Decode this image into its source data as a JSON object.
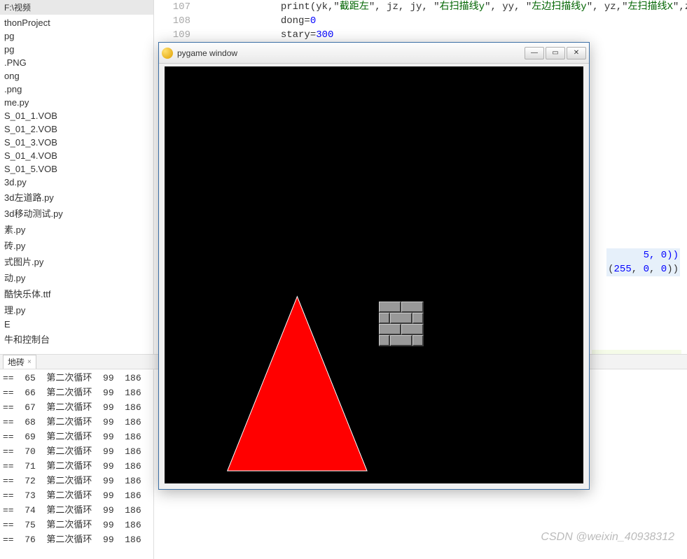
{
  "tree": {
    "header": "F:\\视频",
    "items": [
      "thonProject",
      "pg",
      "pg",
      ".PNG",
      "ong",
      ".png",
      "me.py",
      "S_01_1.VOB",
      "S_01_2.VOB",
      "S_01_3.VOB",
      "S_01_4.VOB",
      "S_01_5.VOB",
      "3d.py",
      "3d左道路.py",
      "3d移动测试.py",
      "素.py",
      "砖.py",
      "式图片.py",
      "动.py",
      "酷快乐体.ttf",
      "理.py",
      "E",
      "牛和控制台"
    ]
  },
  "code": {
    "lines": [
      {
        "n": 107,
        "raw": "print(yk,\"<span class='str'>截距左</span>\", jz, jy, \"<span class='str'>右扫描线y</span>\", yy, \"<span class='str'>左边扫描线y</span>\", yz,\"<span class='str'>左扫描线X</span>\",zuoxianx,\"<span class='str'>左</span>"
      },
      {
        "n": 108,
        "raw": "dong=<span class='num'>0</span>"
      },
      {
        "n": 109,
        "raw": "stary=<span class='num'>300</span>"
      }
    ]
  },
  "farRight": {
    "line1": "5, 0))",
    "line2_pre": "(",
    "line2_a": "255",
    "line2_b": "0",
    "line2_c": "0",
    "line2_post": "))"
  },
  "runTab": {
    "label": "地砖",
    "close": "×"
  },
  "console": {
    "rows": [
      {
        "a": "==",
        "b": "65",
        "c": "第二次循环",
        "d": "99",
        "e": "186"
      },
      {
        "a": "==",
        "b": "66",
        "c": "第二次循环",
        "d": "99",
        "e": "186"
      },
      {
        "a": "==",
        "b": "67",
        "c": "第二次循环",
        "d": "99",
        "e": "186"
      },
      {
        "a": "==",
        "b": "68",
        "c": "第二次循环",
        "d": "99",
        "e": "186"
      },
      {
        "a": "==",
        "b": "69",
        "c": "第二次循环",
        "d": "99",
        "e": "186"
      },
      {
        "a": "==",
        "b": "70",
        "c": "第二次循环",
        "d": "99",
        "e": "186"
      },
      {
        "a": "==",
        "b": "71",
        "c": "第二次循环",
        "d": "99",
        "e": "186"
      },
      {
        "a": "==",
        "b": "72",
        "c": "第二次循环",
        "d": "99",
        "e": "186"
      },
      {
        "a": "==",
        "b": "73",
        "c": "第二次循环",
        "d": "99",
        "e": "186"
      },
      {
        "a": "==",
        "b": "74",
        "c": "第二次循环",
        "d": "99",
        "e": "186"
      },
      {
        "a": "==",
        "b": "75",
        "c": "第二次循环",
        "d": "99",
        "e": "186"
      },
      {
        "a": "==",
        "b": "76",
        "c": "第二次循环",
        "d": "99",
        "e": "186"
      }
    ]
  },
  "pygame": {
    "title": "pygame window"
  },
  "watermark": "CSDN @weixin_40938312"
}
